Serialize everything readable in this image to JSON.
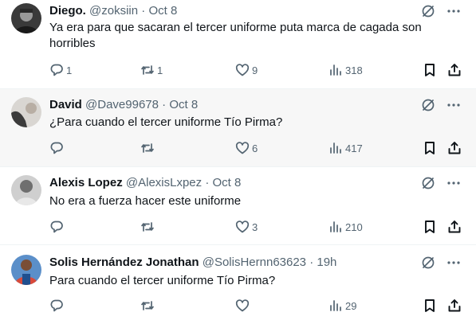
{
  "tweets": [
    {
      "name": "Diego.",
      "handle": "@zoksiin",
      "dot": "·",
      "time": "Oct 8",
      "text": "Ya era para que sacaran el tercer uniforme puta marca de cagada son horribles",
      "replies": "1",
      "reposts": "1",
      "likes": "9",
      "views": "318"
    },
    {
      "name": "David",
      "handle": "@Dave99678",
      "dot": "·",
      "time": "Oct 8",
      "text": "¿Para cuando el tercer uniforme Tío Pirma?",
      "replies": "",
      "reposts": "",
      "likes": "6",
      "views": "417"
    },
    {
      "name": "Alexis Lopez",
      "handle": "@AlexisLxpez",
      "dot": "·",
      "time": "Oct 8",
      "text": "No era a fuerza hacer este uniforme",
      "replies": "",
      "reposts": "",
      "likes": "3",
      "views": "210"
    },
    {
      "name": "Solis Hernández Jonathan",
      "handle": "@SolisHernn63623",
      "dot": "·",
      "time": "19h",
      "text": "Para cuando el tercer uniforme Tío Pirma?",
      "replies": "",
      "reposts": "",
      "likes": "",
      "views": "29"
    }
  ],
  "icons": {
    "top": [
      "grok-icon",
      "more-icon"
    ],
    "actions": [
      "reply-icon",
      "repost-icon",
      "like-icon",
      "views-icon",
      "bookmark-icon",
      "share-icon"
    ]
  },
  "colors": {
    "text": "#0f1419",
    "secondary": "#536471",
    "hover_row": "#f7f7f7",
    "divider": "#eff3f4"
  }
}
